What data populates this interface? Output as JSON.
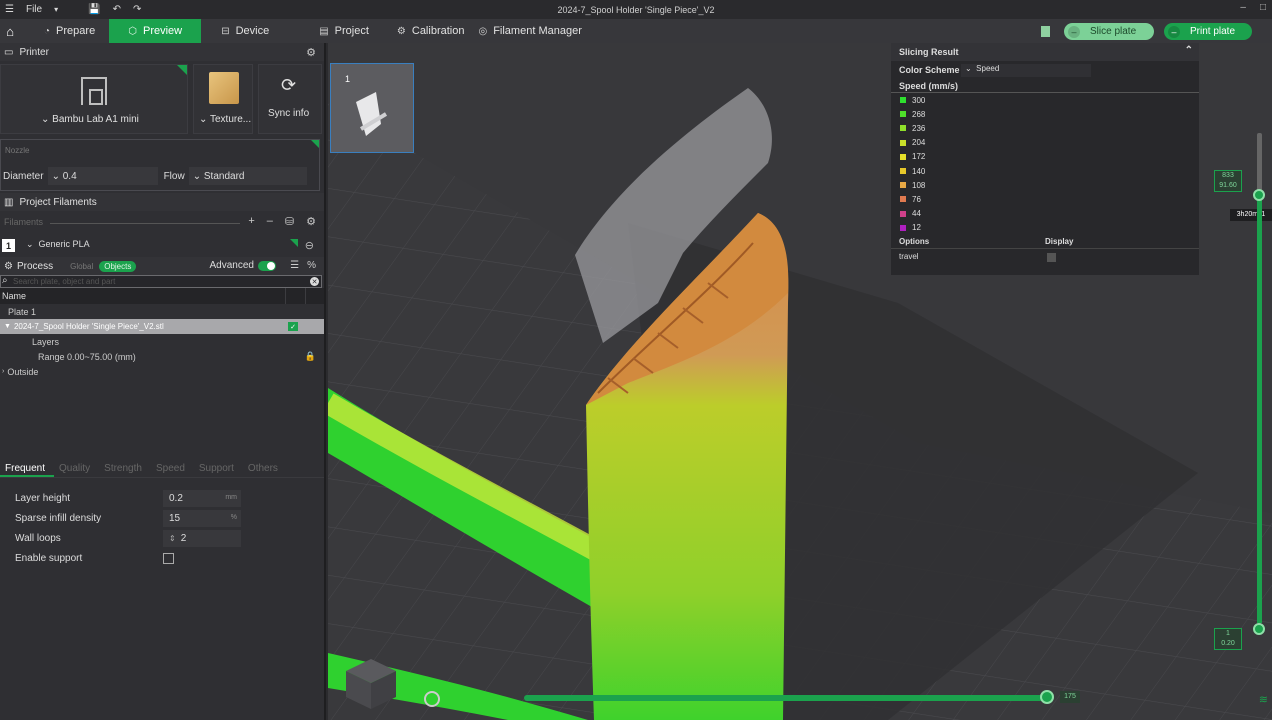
{
  "titlebar": {
    "file_label": "File",
    "title": "2024-7_Spool Holder 'Single Piece'_V2"
  },
  "nav": {
    "tabs": [
      {
        "label": "Prepare",
        "icon": "prepare-icon"
      },
      {
        "label": "Preview",
        "icon": "preview-icon",
        "active": true
      },
      {
        "label": "Device",
        "icon": "device-icon"
      },
      {
        "label": "Project",
        "icon": "project-icon"
      },
      {
        "label": "Calibration",
        "icon": "calibration-icon"
      },
      {
        "label": "Filament Manager",
        "icon": "filament-manager-icon"
      }
    ],
    "slice_label": "Slice plate",
    "print_label": "Print plate",
    "accent": "#1ba24d"
  },
  "printer_section": {
    "title": "Printer",
    "printer_name": "Bambu Lab A1 mini",
    "texture_label": "Texture...",
    "sync_label": "Sync info",
    "nozzle_title": "Nozzle",
    "diameter_label": "Diameter",
    "diameter_value": "0.4",
    "flow_label": "Flow",
    "flow_value": "Standard"
  },
  "filaments": {
    "title": "Project Filaments",
    "placeholder": "Filaments",
    "slot": "1",
    "name": "Generic PLA"
  },
  "process": {
    "label": "Process",
    "seg_global": "Global",
    "seg_objects": "Objects",
    "advanced": "Advanced",
    "search_placeholder": "Search plate, object and part",
    "tree_header": "Name",
    "tree": [
      {
        "label": "Plate 1",
        "indent": 8
      },
      {
        "label": "2024-7_Spool Holder 'Single Piece'_V2.stl",
        "indent": 4,
        "selected": true
      },
      {
        "label": "Layers",
        "indent": 32
      },
      {
        "label": "Range 0.00~75.00 (mm)",
        "indent": 38
      },
      {
        "label": "Outside",
        "indent": 8
      }
    ],
    "tabs": [
      "Frequent",
      "Quality",
      "Strength",
      "Speed",
      "Support",
      "Others"
    ],
    "settings": [
      {
        "label": "Layer height",
        "value": "0.2",
        "unit": "mm"
      },
      {
        "label": "Sparse infill density",
        "value": "15",
        "unit": "%"
      },
      {
        "label": "Wall loops",
        "value": "2",
        "unit": ""
      },
      {
        "label": "Enable support",
        "value": "",
        "unit": "",
        "checkbox": true
      }
    ]
  },
  "slicing_result": {
    "title": "Slicing Result",
    "color_scheme_label": "Color Scheme",
    "color_scheme_value": "Speed",
    "speed_header": "Speed (mm/s)",
    "legend": [
      {
        "value": "300",
        "color": "#2ee02e"
      },
      {
        "value": "268",
        "color": "#4fe02a"
      },
      {
        "value": "236",
        "color": "#8fe02a"
      },
      {
        "value": "204",
        "color": "#c9e02a"
      },
      {
        "value": "172",
        "color": "#e6e02a"
      },
      {
        "value": "140",
        "color": "#e6c82a"
      },
      {
        "value": "108",
        "color": "#e8a845"
      },
      {
        "value": "76",
        "color": "#e07a50"
      },
      {
        "value": "44",
        "color": "#d0408a"
      },
      {
        "value": "12",
        "color": "#b020c0"
      }
    ],
    "options_label": "Options",
    "display_label": "Display",
    "option_travel": "travel"
  },
  "viewport": {
    "plate_number": "1",
    "layer_top_a": "833",
    "layer_top_b": "91.60",
    "time": "3h20m11",
    "layer_bot_a": "1",
    "layer_bot_b": "0.20",
    "move_value": "175",
    "layer_progress": 1.0,
    "move_progress": 1.0
  }
}
